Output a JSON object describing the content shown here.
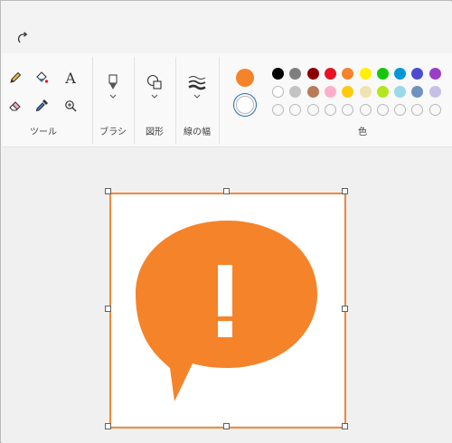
{
  "toolbar": {
    "redo_icon": "redo-icon"
  },
  "groups": {
    "tools": {
      "label": "ツール",
      "text_glyph": "A"
    },
    "brush": {
      "label": "ブラシ"
    },
    "shapes": {
      "label": "図形"
    },
    "stroke": {
      "label": "線の幅"
    },
    "colors": {
      "label": "色"
    }
  },
  "current_colors": {
    "primary": "#f5832a",
    "secondary": "#ffffff"
  },
  "palette": {
    "row1": [
      "#000000",
      "#7f7f7f",
      "#8b0000",
      "#e81123",
      "#f5832a",
      "#fff100",
      "#16c60c",
      "#0098d8",
      "#4c4cd0",
      "#9a3ec8"
    ],
    "row2": [
      "#ffffff",
      "#c3c3c3",
      "#b97a57",
      "#ffaec9",
      "#ffc90e",
      "#efe4b0",
      "#b5e61d",
      "#99d9ea",
      "#7092be",
      "#c8bfe7"
    ],
    "row3_empty_slots": 10
  },
  "canvas": {
    "background": "#ffffff",
    "image": {
      "shape": "speech-bubble-exclamation",
      "fill": "#f5832a",
      "mark_color": "#ffffff"
    },
    "selection_border_color": "#f38a3b"
  }
}
